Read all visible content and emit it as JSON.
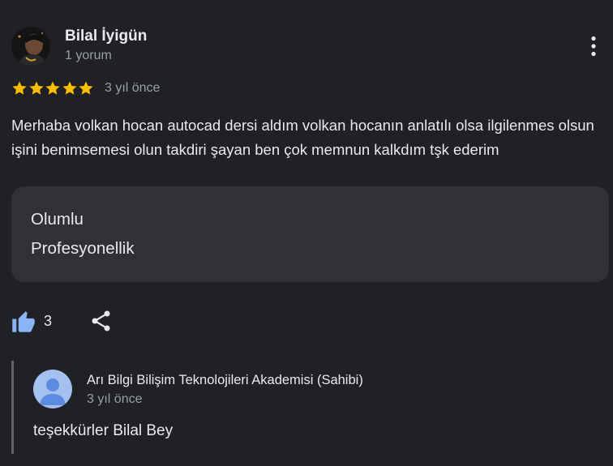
{
  "review": {
    "author_name": "Bilal İyigün",
    "author_meta": "1 yorum",
    "rating": 5,
    "rating_max": 5,
    "date": "3 yıl önce",
    "text": "Merhaba volkan hocan autocad dersi aldım volkan hocanın anlatılı olsa ilgilenmes olsun işini benimsemesi olun takdiri şayan ben çok memnun kalkdım tşk ederim",
    "attributes": [
      "Olumlu",
      "Profesyonellik"
    ],
    "likes": "3"
  },
  "owner_reply": {
    "name": "Arı Bilgi Bilişim Teknolojileri Akademisi (Sahibi)",
    "date": "3 yıl önce",
    "text": "teşekkürler Bilal Bey"
  },
  "icons": {
    "star": "star-icon",
    "more": "more-vert-icon",
    "like": "thumb-up-icon",
    "share": "share-icon",
    "owner_avatar": "person-icon"
  },
  "colors": {
    "background": "#202124",
    "star": "#fbbc04",
    "like": "#8ab4f8",
    "secondary_text": "#9aa0a6",
    "attribute_box": "#303134",
    "owner_avatar": "#a4c0ee"
  }
}
